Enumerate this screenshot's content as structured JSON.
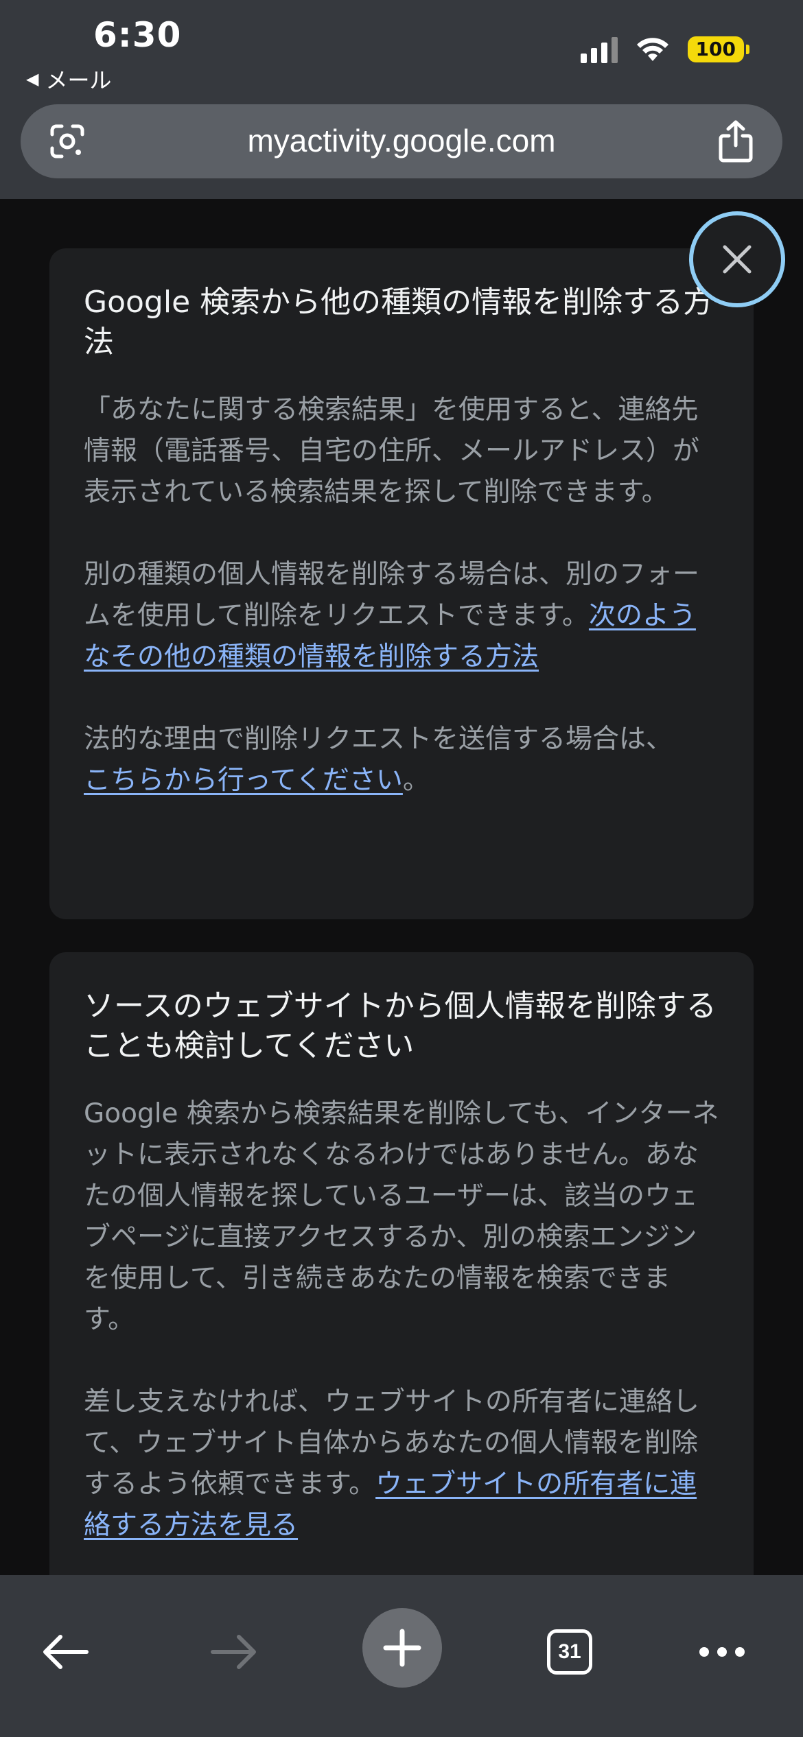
{
  "status_bar": {
    "time": "6:30",
    "back_app_label": "メール",
    "battery_level": "100"
  },
  "browser": {
    "url": "myactivity.google.com"
  },
  "card1": {
    "title": "Google 検索から他の種類の情報を削除する方法",
    "para1": "「あなたに関する検索結果」を使用すると、連絡先情報（電話番号、自宅の住所、メールアドレス）が表示されている検索結果を探して削除できます。",
    "para2_text": "別の種類の個人情報を削除する場合は、別のフォームを使用して削除をリクエストできます。",
    "para2_link": "次のようなその他の種類の情報を削除する方法",
    "para3_text": "法的な理由で削除リクエストを送信する場合は、",
    "para3_link": "こちらから行ってください",
    "para3_end": "。"
  },
  "card2": {
    "title": "ソースのウェブサイトから個人情報を削除することも検討してください",
    "para1": "Google 検索から検索結果を削除しても、インターネットに表示されなくなるわけではありません。あなたの個人情報を探しているユーザーは、該当のウェブページに直接アクセスするか、別の検索エンジンを使用して、引き続きあなたの情報を検索できます。",
    "para2_text": "差し支えなければ、ウェブサイトの所有者に連絡して、ウェブサイト自体からあなたの個人情報を削除するよう依頼できます。",
    "para2_link": "ウェブサイトの所有者に連絡する方法を見る"
  },
  "toolbar": {
    "tab_count": "31"
  },
  "colors": {
    "chrome_bg": "#36393e",
    "card_bg": "#1e1f21",
    "link": "#8ab4f8",
    "body_text": "#9aa0a6",
    "close_ring": "#8fcdf5",
    "battery": "#f5d90a"
  },
  "icons": [
    "back-triangle-icon",
    "signal-icon",
    "wifi-icon",
    "battery-icon",
    "google-lens-icon",
    "share-icon",
    "close-icon",
    "back-arrow-icon",
    "forward-arrow-icon",
    "plus-icon",
    "tabs-icon",
    "more-icon"
  ]
}
